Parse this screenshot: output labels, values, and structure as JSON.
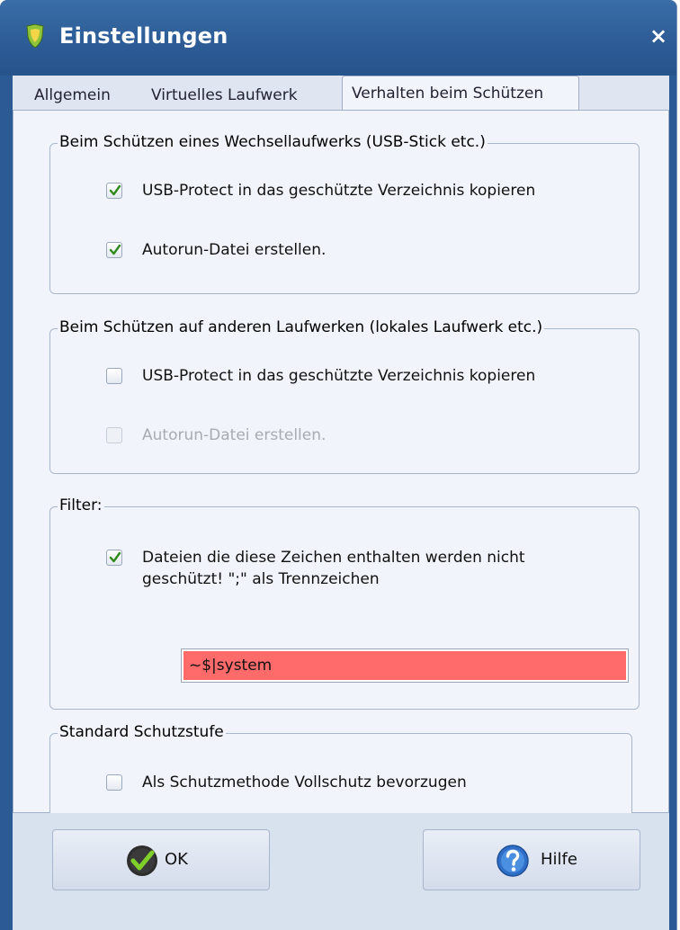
{
  "window": {
    "title": "Einstellungen",
    "close_label": "×"
  },
  "tabs": [
    {
      "label": "Allgemein"
    },
    {
      "label": "Virtuelles Laufwerk"
    },
    {
      "label": "Verhalten beim Schützen"
    }
  ],
  "groups": {
    "removable": {
      "title": "Beim Schützen eines Wechsellaufwerks (USB-Stick etc.)",
      "options": [
        {
          "label": "USB-Protect in das geschützte Verzeichnis kopieren",
          "checked": true,
          "enabled": true
        },
        {
          "label": "Autorun-Datei erstellen.",
          "checked": true,
          "enabled": true
        }
      ]
    },
    "other": {
      "title": "Beim Schützen auf anderen Laufwerken (lokales Laufwerk etc.)",
      "options": [
        {
          "label": "USB-Protect in das geschützte Verzeichnis kopieren",
          "checked": false,
          "enabled": true
        },
        {
          "label": "Autorun-Datei erstellen.",
          "checked": false,
          "enabled": false
        }
      ]
    },
    "filter": {
      "title": "Filter:",
      "option_line1": "Dateien die diese Zeichen enthalten werden nicht",
      "option_line2": "geschützt! \";\" als Trennzeichen",
      "checked": true,
      "value": "~$|system"
    },
    "standard": {
      "title": "Standard Schutzstufe",
      "option": {
        "label": "Als Schutzmethode Vollschutz bevorzugen",
        "checked": false
      }
    }
  },
  "buttons": {
    "ok": "OK",
    "help": "Hilfe"
  },
  "colors": {
    "titlebar": "#2c5a94",
    "client_bg": "#dfe6f1",
    "filter_field_bg": "#ff6b6b"
  }
}
